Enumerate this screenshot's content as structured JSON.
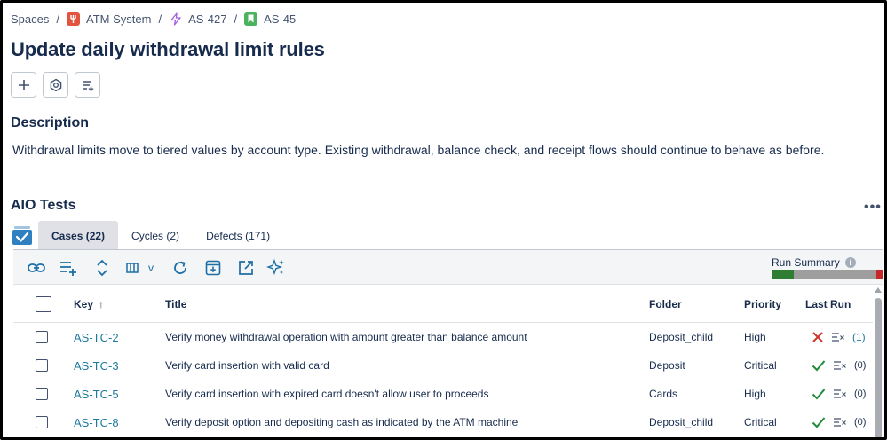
{
  "breadcrumb": {
    "spaces": "Spaces",
    "project": "ATM System",
    "epic": "AS-427",
    "story": "AS-45",
    "separator": "/"
  },
  "issue": {
    "title": "Update daily withdrawal limit rules"
  },
  "actions": [
    {
      "icon": "plus-icon"
    },
    {
      "icon": "settings-icon"
    },
    {
      "icon": "list-add-icon"
    }
  ],
  "description": {
    "heading": "Description",
    "text": "Withdrawal limits move to tiered values by account type. Existing withdrawal, balance check, and receipt flows should continue to behave as before."
  },
  "aio": {
    "heading": "AIO Tests",
    "more": "•••",
    "tabs": [
      {
        "label": "Cases (22)",
        "active": true
      },
      {
        "label": "Cycles (2)",
        "active": false
      },
      {
        "label": "Defects (171)",
        "active": false
      }
    ],
    "toolbar": {
      "icons": [
        "link-icon",
        "add-list-icon",
        "sort-icon",
        "columns-icon",
        "chevron-down-icon",
        "refresh-icon",
        "archive-icon",
        "open-external-icon",
        "sparkle-icon"
      ],
      "columns_caret": "v",
      "run_summary_label": "Run Summary",
      "info_glyph": "i",
      "run_summary": {
        "passed": 0.2,
        "not_run": 0.74,
        "failed": 0.06
      },
      "colors": {
        "passed": "#2e7d32",
        "not_run": "#9e9e9e",
        "failed": "#c62828"
      }
    },
    "table": {
      "columns": {
        "key": "Key",
        "sort_arrow": "↑",
        "title": "Title",
        "folder": "Folder",
        "priority": "Priority",
        "last_run": "Last Run"
      },
      "rows": [
        {
          "key": "AS-TC-2",
          "title": "Verify money withdrawal operation with amount greater than balance amount",
          "folder": "Deposit_child",
          "priority": "High",
          "status": "failed",
          "runs": "(1)"
        },
        {
          "key": "AS-TC-3",
          "title": "Verify card insertion with valid card",
          "folder": "Deposit",
          "priority": "Critical",
          "status": "passed",
          "runs": "(0)"
        },
        {
          "key": "AS-TC-5",
          "title": "Verify card insertion with expired card doesn't allow user to proceeds",
          "folder": "Cards",
          "priority": "High",
          "status": "passed",
          "runs": "(0)"
        },
        {
          "key": "AS-TC-8",
          "title": "Verify deposit option and depositing cash as indicated by the ATM machine",
          "folder": "Deposit_child",
          "priority": "Critical",
          "status": "passed",
          "runs": "(0)"
        }
      ]
    }
  }
}
